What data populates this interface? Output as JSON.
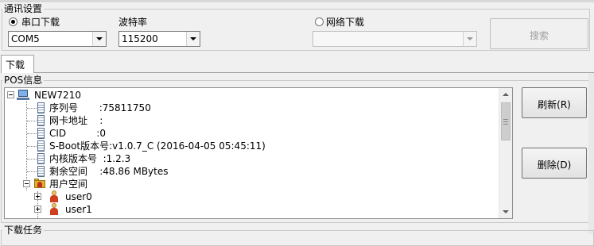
{
  "comm": {
    "group_title": "通讯设置",
    "serial_label": "串口下载",
    "baud_label": "波特率",
    "network_label": "网络下载",
    "port_value": "COM5",
    "baud_value": "115200",
    "network_value": "",
    "search_label": "搜索",
    "selected_mode": "serial"
  },
  "tabs": [
    {
      "label": "下载",
      "active": true
    }
  ],
  "pos": {
    "group_title": "POS信息",
    "root": "NEW7210",
    "items": [
      {
        "text": "序列号       :75811750"
      },
      {
        "text": "网卡地址    :"
      },
      {
        "text": "CID          :0"
      },
      {
        "text": "S-Boot版本号:v1.0.7_C (2016-04-05 05:45:11)"
      },
      {
        "text": "内核版本号  :1.2.3"
      },
      {
        "text": "剩余空间    :48.86 MBytes"
      }
    ],
    "user_space": "用户空间",
    "users": [
      "user0",
      "user1"
    ]
  },
  "actions": {
    "refresh_label": "刷新(R)",
    "delete_label": "删除(D)"
  },
  "download_task": {
    "group_title": "下载任务"
  }
}
